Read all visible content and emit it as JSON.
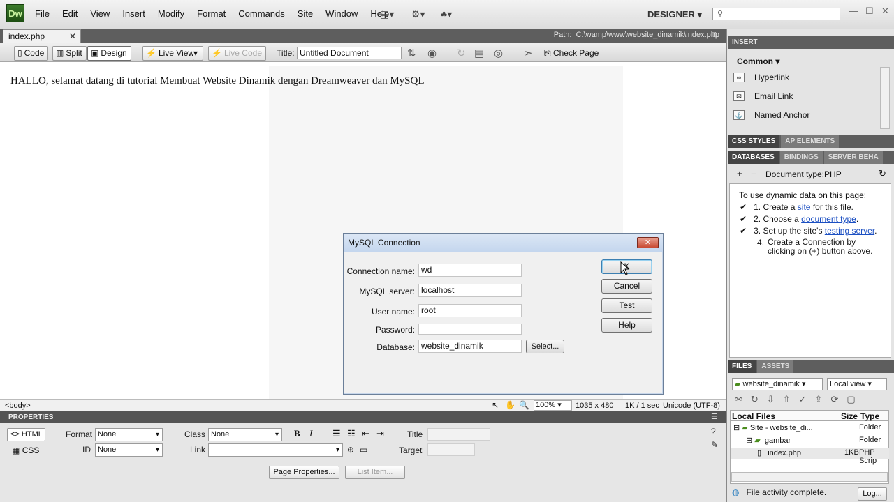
{
  "app": {
    "logo": "Dw",
    "menu": [
      "File",
      "Edit",
      "View",
      "Insert",
      "Modify",
      "Format",
      "Commands",
      "Site",
      "Window",
      "Help"
    ],
    "workspace": "DESIGNER"
  },
  "document": {
    "tab": "index.php",
    "tab_close": "✕",
    "path_label": "Path:",
    "path": "C:\\wamp\\www\\website_dinamik\\index.php",
    "toolbar": {
      "code": "Code",
      "split": "Split",
      "design": "Design",
      "live_view": "Live View",
      "live_code": "Live Code",
      "title_label": "Title:",
      "title_value": "Untitled Document",
      "check_page": "Check Page"
    },
    "body_text": "HALLO, selamat datang di tutorial Membuat Website Dinamik dengan Dreamweaver dan MySQL",
    "status": {
      "tag": "<body>",
      "zoom": "100%",
      "size": "1035 x 480",
      "download": "1K / 1 sec",
      "encoding": "Unicode (UTF-8)"
    }
  },
  "properties": {
    "header": "PROPERTIES",
    "html": "HTML",
    "css": "CSS",
    "format_label": "Format",
    "format_value": "None",
    "class_label": "Class",
    "class_value": "None",
    "id_label": "ID",
    "id_value": "None",
    "link_label": "Link",
    "link_value": "",
    "title_label": "Title",
    "target_label": "Target",
    "bold": "B",
    "italic": "I",
    "page_properties": "Page Properties...",
    "list_item": "List Item..."
  },
  "right_panel": {
    "insert_tab": "INSERT",
    "insert_category": "Common",
    "insert_items": [
      "Hyperlink",
      "Email Link",
      "Named Anchor"
    ],
    "css_tabs": [
      "CSS STYLES",
      "AP ELEMENTS"
    ],
    "db_tabs": [
      "DATABASES",
      "BINDINGS",
      "SERVER BEHA"
    ],
    "doc_type": "Document type:PHP",
    "intro": "To use dynamic data on this page:",
    "steps": [
      {
        "n": "1.",
        "pre": "Create a ",
        "link": "site",
        "post": " for this file.",
        "check": true
      },
      {
        "n": "2.",
        "pre": "Choose a ",
        "link": "document type",
        "post": ".",
        "check": true
      },
      {
        "n": "3.",
        "pre": "Set up the site's ",
        "link": "testing server",
        "post": ".",
        "check": true
      },
      {
        "n": "4.",
        "pre": "Create a Connection by clicking on (+) button above.",
        "link": "",
        "post": "",
        "check": false
      }
    ],
    "files_tabs": [
      "FILES",
      "ASSETS"
    ],
    "site_select": "website_dinamik",
    "view_select": "Local view",
    "files_header": {
      "name": "Local Files",
      "size": "Size",
      "type": "Type"
    },
    "files": [
      {
        "name": "Site - website_di...",
        "size": "",
        "type": "Folder"
      },
      {
        "name": "gambar",
        "size": "",
        "type": "Folder"
      },
      {
        "name": "index.php",
        "size": "1KB",
        "type": "PHP Scrip"
      }
    ],
    "status": "File activity complete.",
    "log": "Log..."
  },
  "dialog": {
    "title": "MySQL Connection",
    "close": "✕",
    "fields": [
      {
        "label": "Connection name:",
        "value": "wd"
      },
      {
        "label": "MySQL server:",
        "value": "localhost"
      },
      {
        "label": "User name:",
        "value": "root"
      },
      {
        "label": "Password:",
        "value": ""
      },
      {
        "label": "Database:",
        "value": "website_dinamik"
      }
    ],
    "select_button": "Select...",
    "buttons": {
      "ok": "K",
      "cancel": "Cancel",
      "test": "Test",
      "help": "Help"
    }
  }
}
